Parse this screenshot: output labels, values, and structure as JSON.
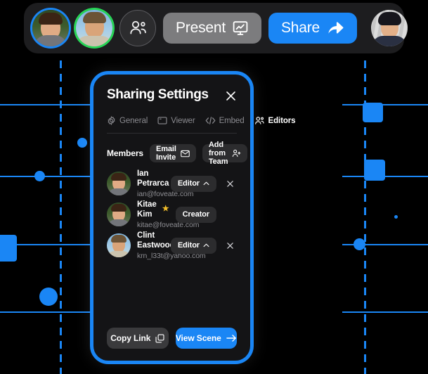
{
  "colors": {
    "accent_blue": "#1a86f5",
    "toolbar_bg": "#1d1d1f",
    "dialog_bg": "#141416",
    "button_gray": "#2c2c2e",
    "present_gray": "#7c7c7e",
    "star_gold": "#f5c02a",
    "ring_blue": "#1a86f5",
    "ring_green": "#27d556",
    "muted_text": "#8e8e93"
  },
  "toolbar": {
    "avatars": [
      {
        "name": "avatar-ian",
        "ring": "blue"
      },
      {
        "name": "avatar-clint",
        "ring": "green"
      }
    ],
    "group_icon": "people-icon",
    "present": {
      "label": "Present",
      "icon": "presentation-chart-icon"
    },
    "share": {
      "label": "Share",
      "icon": "share-arrow-icon"
    },
    "right_avatar": {
      "name": "avatar-kitae",
      "ring": "none"
    }
  },
  "dialog": {
    "title": "Sharing Settings",
    "close_icon": "close-icon",
    "tabs": [
      {
        "label": "General",
        "icon": "gear-icon",
        "active": false
      },
      {
        "label": "Viewer",
        "icon": "window-icon",
        "active": false
      },
      {
        "label": "Embed",
        "icon": "code-icon",
        "active": false
      },
      {
        "label": "Editors",
        "icon": "people-icon",
        "active": true
      }
    ],
    "members_label": "Members",
    "actions": [
      {
        "label": "Email Invite",
        "icon": "envelope-icon"
      },
      {
        "label": "Add from Team",
        "icon": "person-plus-icon"
      }
    ],
    "members": [
      {
        "name": "Ian Petrarca",
        "email": "ian@foveate.com",
        "role": "Editor",
        "role_icon": "chevron-up-icon",
        "removable": true,
        "starred": false
      },
      {
        "name": "Kitae Kim",
        "email": "kitae@foveate.com",
        "role": "Creator",
        "role_icon": "",
        "removable": false,
        "starred": true,
        "star_glyph": "★"
      },
      {
        "name": "Clint Eastwood",
        "email": "krn_l33t@yahoo.com",
        "role": "Editor",
        "role_icon": "chevron-up-icon",
        "removable": true,
        "starred": false
      }
    ],
    "footer": {
      "copy_link": {
        "label": "Copy Link",
        "icon": "copy-icon"
      },
      "view_scene": {
        "label": "View Scene",
        "icon": "arrow-right-icon"
      }
    }
  }
}
